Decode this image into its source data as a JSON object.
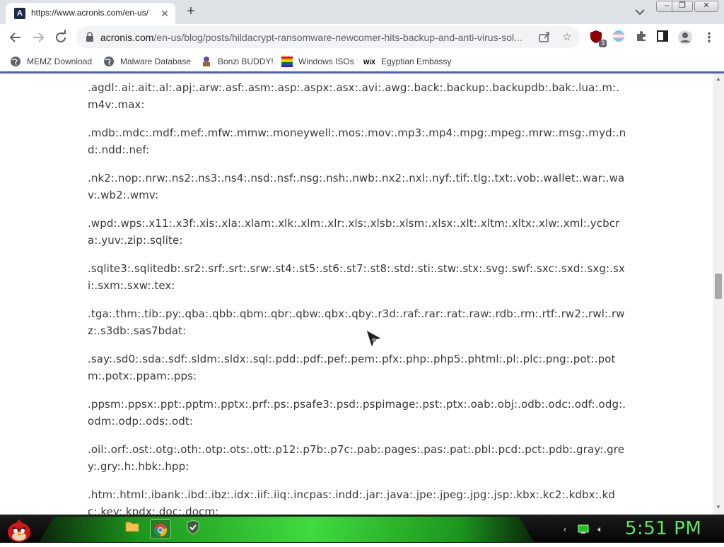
{
  "tab": {
    "title": "https://www.acronis.com/en-us/",
    "favicon_letter": "A"
  },
  "window_controls": {
    "minimize": "–",
    "restore": "❐",
    "close": "✕"
  },
  "toolbar": {
    "url_domain": "acronis.com",
    "url_path": "/en-us/blog/posts/hildacrypt-ransomware-newcomer-hits-backup-and-anti-virus-sol...",
    "extension_badge": "3"
  },
  "bookmarks": [
    {
      "label": "MEMZ Download",
      "icon": "globe-icon"
    },
    {
      "label": "Malware Database",
      "icon": "globe-icon"
    },
    {
      "label": "Bonzi BUDDY!",
      "icon": "bonzi-icon"
    },
    {
      "label": "Windows ISOs",
      "icon": "windows-flag-icon"
    },
    {
      "label": "Egyptian Embassy",
      "icon": "wix-icon"
    }
  ],
  "wix_logo_text": "WiX",
  "content": {
    "paragraphs": [
      ".agdl:.ai:.ait:.al:.apj:.arw:.asf:.asm:.asp:.aspx:.asx:.avi:.awg:.back:.backup:.backupdb:.bak:.lua:.m:.m4v:.max:",
      ".mdb:.mdc:.mdf:.mef:.mfw:.mmw:.moneywell:.mos:.mov:.mp3:.mp4:.mpg:.mpeg:.mrw:.msg:.myd:.nd:.ndd:.nef:",
      ".nk2:.nop:.nrw:.ns2:.ns3:.ns4:.nsd:.nsf:.nsg:.nsh:.nwb:.nx2:.nxl:.nyf:.tif:.tlg:.txt:.vob:.wallet:.war:.wav:.wb2:.wmv:",
      ".wpd:.wps:.x11:.x3f:.xis:.xla:.xlam:.xlk:.xlm:.xlr:.xls:.xlsb:.xlsm:.xlsx:.xlt:.xltm:.xltx:.xlw:.xml:.ycbcra:.yuv:.zip:.sqlite:",
      ".sqlite3:.sqlitedb:.sr2:.srf:.srt:.srw:.st4:.st5:.st6:.st7:.st8:.std:.sti:.stw:.stx:.svg:.swf:.sxc:.sxd:.sxg:.sxi:.sxm:.sxw:.tex:",
      ".tga:.thm:.tib:.py:.qba:.qbb:.qbm:.qbr:.qbw:.qbx:.qby:.r3d:.raf:.rar:.rat:.raw:.rdb:.rm:.rtf:.rw2:.rwl:.rwz:.s3db:.sas7bdat:",
      ".say:.sd0:.sda:.sdf:.sldm:.sldx:.sql:.pdd:.pdf:.pef:.pem:.pfx:.php:.php5:.phtml:.pl:.plc:.png:.pot:.potm:.potx:.ppam:.pps:",
      ".ppsm:.ppsx:.ppt:.pptm:.pptx:.prf:.ps:.psafe3:.psd:.pspimage:.pst:.ptx:.oab:.obj:.odb:.odc:.odf:.odg:.odm:.odp:.ods:.odt:",
      ".oil:.orf:.ost:.otg:.oth:.otp:.ots:.ott:.p12:.p7b:.p7c:.pab:.pages:.pas:.pat:.pbl:.pcd:.pct:.pdb:.gray:.grey:.gry:.h:.hbk:.hpp:",
      ".htm:.html:.ibank:.ibd:.ibz:.idx:.iif:.iiq:.incpas:.indd:.jar:.java:.jpe:.jpeg:.jpg:.jsp:.kbx:.kc2:.kdbx:.kdc:.key:.kpdx:.doc:.docm:"
    ]
  },
  "taskbar": {
    "clock": "5:51 PM"
  },
  "colors": {
    "accent_blue": "#4a5fc8",
    "taskbar_green": "#48ff48",
    "clock_green": "#5fe65f"
  }
}
